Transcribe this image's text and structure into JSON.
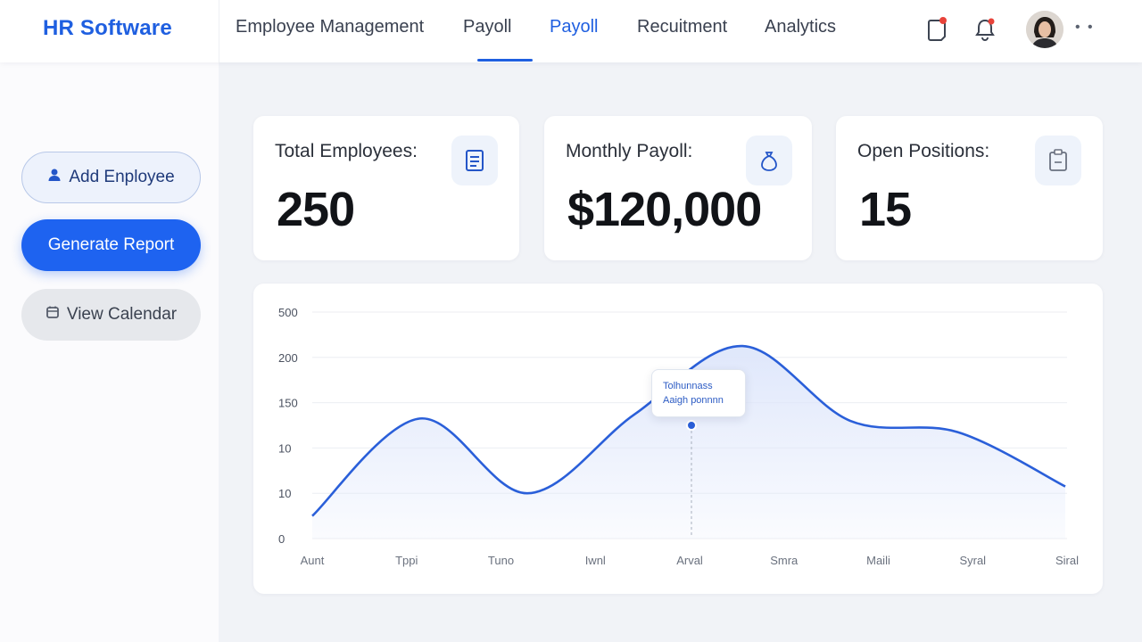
{
  "app": {
    "title": "HR Software"
  },
  "nav": {
    "items": [
      {
        "label": "Employee Management",
        "active": false
      },
      {
        "label": "Payoll",
        "active": false
      },
      {
        "label": "Payoll",
        "active": true
      },
      {
        "label": "Recuitment",
        "active": false
      },
      {
        "label": "Analytics",
        "active": false
      }
    ]
  },
  "header": {
    "icons": [
      "clipboard-alert-icon",
      "bell-icon"
    ],
    "more_label": "• •"
  },
  "sidebar": {
    "add_employee": "Add Enployee",
    "generate_report": "Generate Report",
    "view_calendar": "View Calendar"
  },
  "stats": [
    {
      "label": "Total Employees:",
      "value": "250",
      "icon": "document-icon"
    },
    {
      "label": "Monthly Payoll:",
      "value": "$120,000",
      "icon": "money-bag-icon"
    },
    {
      "label": "Open Positions:",
      "value": "15",
      "icon": "clipboard-icon"
    }
  ],
  "chart_data": {
    "type": "area",
    "y_ticks": [
      "500",
      "200",
      "150",
      "10",
      "10",
      "0"
    ],
    "x": [
      "Aunt",
      "Tppi",
      "Tuno",
      "Iwnl",
      "Arval",
      "Smra",
      "Maili",
      "Syral",
      "Siral"
    ],
    "values": [
      0.1,
      0.53,
      0.2,
      0.55,
      0.85,
      0.52,
      0.47,
      0.23
    ],
    "ylim": [
      0,
      1
    ],
    "tooltip": {
      "line1": "Tolhunnass",
      "line2": "Aaigh ponnnn"
    },
    "colors": {
      "line": "#2a5fd9",
      "fill": "#dfe7fb"
    }
  },
  "colors": {
    "accent": "#1f5fe0",
    "brand": "#1f5fe0"
  }
}
